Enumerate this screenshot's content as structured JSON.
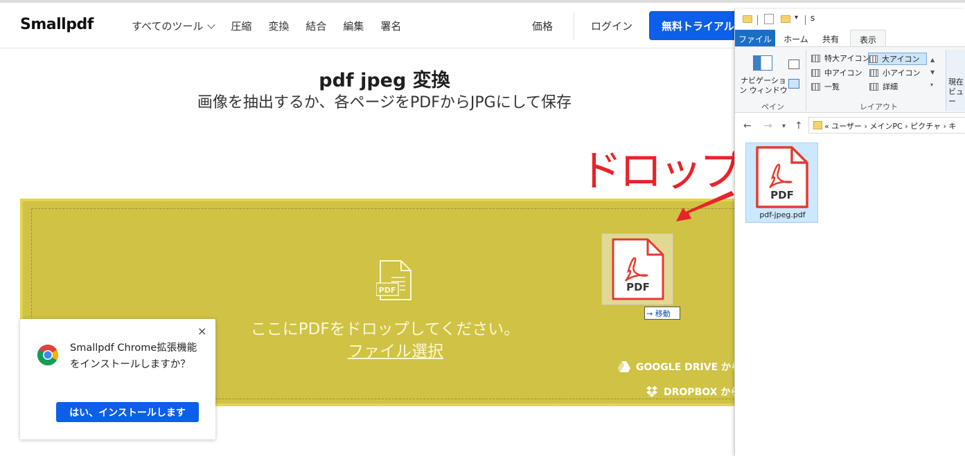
{
  "nav": {
    "logo": "Smallpdf",
    "links": [
      "すべてのツール",
      "圧縮",
      "変換",
      "結合",
      "編集",
      "署名"
    ],
    "pricing": "価格",
    "login": "ログイン",
    "trial_button": "無料トライアル"
  },
  "hero": {
    "title": "pdf jpeg 変換",
    "subtitle": "画像を抽出するか、各ページをPDFからJPGにして保存"
  },
  "annotation": {
    "drop_label": "ドロップ",
    "color": "#e8232a"
  },
  "dropzone": {
    "icon_label": "PDF",
    "drop_text": "ここにPDFをドロップしてください。",
    "file_select": "ファイル選択",
    "google_drive": "GOOGLE DRIVE から",
    "dropbox": "DROPBOX から",
    "background_color": "#cfc245",
    "drag_icon_label": "PDF",
    "move_tooltip": "移動"
  },
  "popup": {
    "close": "×",
    "message": "Smallpdf Chrome拡張機能をインストールしますか？",
    "install_button": "はい、インストールします"
  },
  "explorer": {
    "title": "s",
    "tabs": [
      "ファイル",
      "ホーム",
      "共有",
      "表示"
    ],
    "active_tab": "表示",
    "navigation_pane_label": "ナビゲーション ウィンドウ",
    "pane_group": "ペイン",
    "layout_group": "レイアウト",
    "layout_options": [
      "特大アイコン",
      "大アイコン",
      "中アイコン",
      "小アイコン",
      "一覧",
      "詳細"
    ],
    "selected_layout": "大アイコン",
    "right_group_text": "現在 ビュー",
    "breadcrumb": "« ユーザー › メインPC › ピクチャ › キ",
    "file_name": "pdf-jpeg.pdf",
    "file_icon_label": "PDF"
  },
  "colors": {
    "brand_blue": "#0c5fe8",
    "pdf_red": "#e33b2e"
  }
}
